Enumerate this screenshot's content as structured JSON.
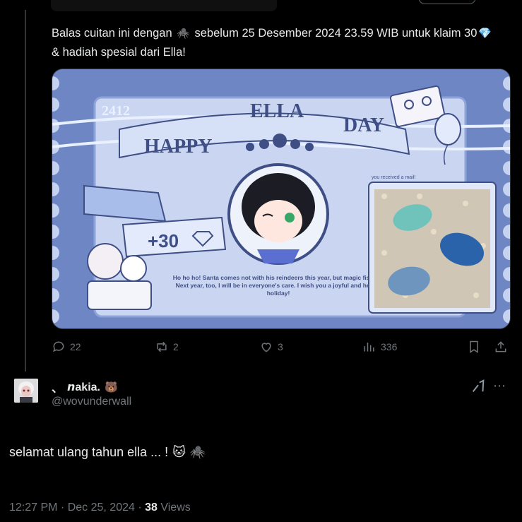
{
  "parent_tweet": {
    "text_before_spider": "Balas cuitan ini dengan",
    "spider_emoji": "🕷️",
    "text_after_spider": "sebelum 25 Desember 2024 23.59 WIB untuk klaim 30",
    "diamond_emoji": "💎",
    "text_end": "& hadiah spesial dari Ella!",
    "media": {
      "badge_number": "2412",
      "headline_words": [
        "HAPPY",
        "ELLA",
        "DAY"
      ],
      "reward": "+30",
      "mail_label": "you received a mail!",
      "message": "Ho ho ho! Santa comes not with his reindeers this year, but magic fishies! Next year, too, I will be in everyone's care. I wish you a joyful and hearty holiday!",
      "colors": {
        "frame": "#6f86c4",
        "paper": "#cad6f1",
        "ribbon": "#8fa6dc",
        "text_dark": "#3f4f86"
      }
    },
    "stats": {
      "replies": "22",
      "reposts": "2",
      "likes": "3",
      "views": "336"
    },
    "icons": [
      "reply-icon",
      "repost-icon",
      "like-icon",
      "views-icon",
      "bookmark-icon",
      "share-icon"
    ]
  },
  "reply": {
    "display_name_prefix": "、",
    "display_name": "𝙣akia.",
    "name_emoji": "🐻",
    "handle": "@wovunderwall",
    "text": "selamat ulang tahun ella ... !",
    "text_emojis": [
      "🐱",
      "🕷️"
    ],
    "time": "12:27 PM · Dec 25, 2024 ·",
    "views_count": "38",
    "views_label": "Views"
  }
}
